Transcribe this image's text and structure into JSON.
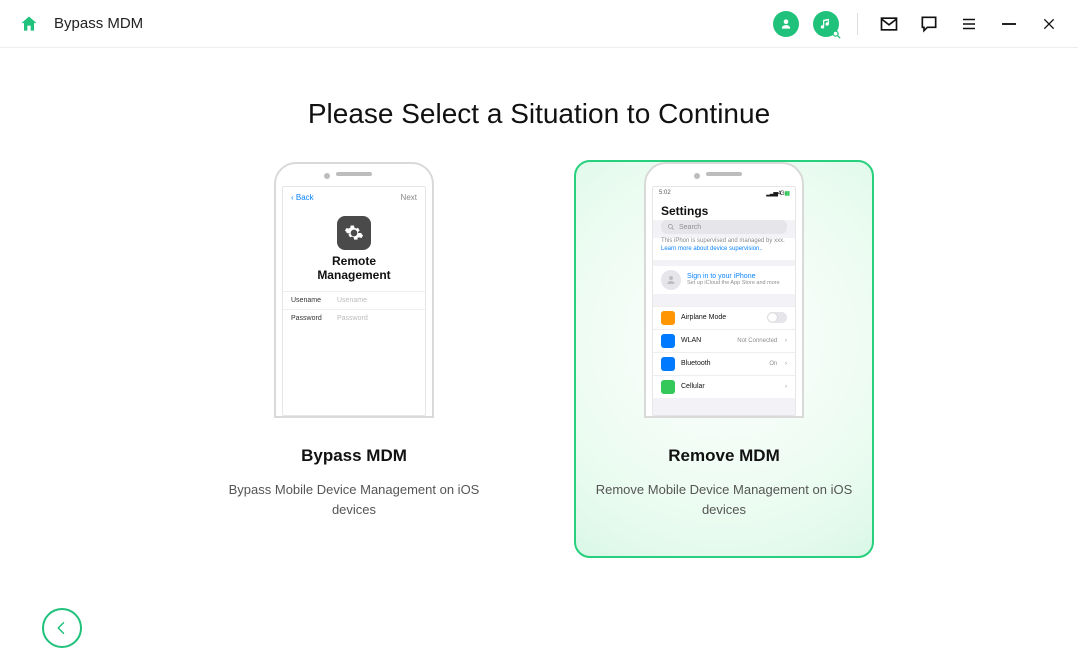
{
  "title": "Bypass MDM",
  "heading": "Please Select a Situation to Continue",
  "cards": {
    "bypass": {
      "title": "Bypass MDM",
      "desc": "Bypass Mobile Device Management on iOS devices",
      "phone": {
        "back": "Back",
        "next": "Next",
        "title_line1": "Remote",
        "title_line2": "Management",
        "username_label": "Usename",
        "username_ph": "Usename",
        "password_label": "Password",
        "password_ph": "Password"
      }
    },
    "remove": {
      "title": "Remove MDM",
      "desc": "Remove Mobile Device Management on iOS devices",
      "phone": {
        "time": "5:02",
        "signal": "▂▃▅ 4G",
        "battery_icon": "▮▮",
        "heading": "Settings",
        "search_ph": "Search",
        "supervised_text": "This iPhon is supervised and managed by xxx. ",
        "supervised_link": "Learn more about device supervision..",
        "signin_title": "Sign in to your iPhone",
        "signin_sub": "Set up iCloud the App Store and more",
        "rows": {
          "airplane": "Airplane Mode",
          "wlan": "WLAN",
          "wlan_val": "Not Connected",
          "bluetooth": "Bluetooth",
          "bluetooth_val": "On",
          "cellular": "Cellular"
        }
      }
    }
  }
}
